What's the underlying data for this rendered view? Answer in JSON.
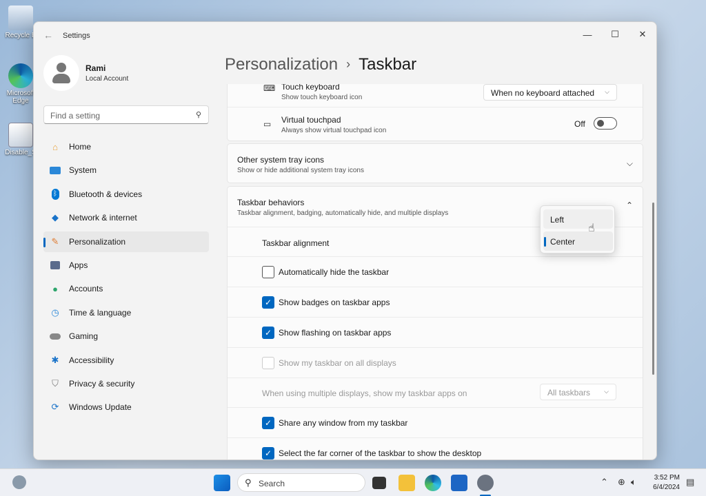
{
  "desktop": {
    "icons": [
      {
        "label": "Recycle B",
        "icon": "recycle-bin-icon"
      },
      {
        "label": "Microsoft Edge",
        "icon": "edge-icon"
      },
      {
        "label": "Disable_S",
        "icon": "script-icon"
      }
    ]
  },
  "window": {
    "title": "Settings",
    "controls": {
      "minimize": "—",
      "maximize": "☐",
      "close": "✕"
    }
  },
  "profile": {
    "name": "Rami",
    "account": "Local Account"
  },
  "search": {
    "placeholder": "Find a setting"
  },
  "nav": [
    {
      "label": "Home",
      "icon": "home-icon",
      "color": "#e8a33d"
    },
    {
      "label": "System",
      "icon": "system-icon",
      "color": "#2b88d8"
    },
    {
      "label": "Bluetooth & devices",
      "icon": "bluetooth-icon",
      "color": "#0078d4"
    },
    {
      "label": "Network & internet",
      "icon": "network-icon",
      "color": "#1a73c9"
    },
    {
      "label": "Personalization",
      "icon": "brush-icon",
      "color": "#e07a2f",
      "active": true
    },
    {
      "label": "Apps",
      "icon": "apps-icon",
      "color": "#5a6b8c"
    },
    {
      "label": "Accounts",
      "icon": "accounts-icon",
      "color": "#2da56c"
    },
    {
      "label": "Time & language",
      "icon": "time-icon",
      "color": "#2b88d8"
    },
    {
      "label": "Gaming",
      "icon": "gaming-icon",
      "color": "#777"
    },
    {
      "label": "Accessibility",
      "icon": "accessibility-icon",
      "color": "#1a73c9"
    },
    {
      "label": "Privacy & security",
      "icon": "shield-icon",
      "color": "#777"
    },
    {
      "label": "Windows Update",
      "icon": "update-icon",
      "color": "#1a73c9"
    }
  ],
  "breadcrumb": {
    "parent": "Personalization",
    "separator": "›",
    "current": "Taskbar"
  },
  "touch_keyboard": {
    "title": "Touch keyboard",
    "subtitle": "Show touch keyboard icon",
    "value": "When no keyboard attached"
  },
  "virtual_touchpad": {
    "title": "Virtual touchpad",
    "subtitle": "Always show virtual touchpad icon",
    "state": "Off"
  },
  "other_tray": {
    "title": "Other system tray icons",
    "subtitle": "Show or hide additional system tray icons"
  },
  "behaviors": {
    "title": "Taskbar behaviors",
    "subtitle": "Taskbar alignment, badging, automatically hide, and multiple displays",
    "alignment_label": "Taskbar alignment",
    "alignment_options": [
      "Left",
      "Center"
    ],
    "alignment_selected": "Center",
    "checks": [
      {
        "label": "Automatically hide the taskbar",
        "checked": false
      },
      {
        "label": "Show badges on taskbar apps",
        "checked": true
      },
      {
        "label": "Show flashing on taskbar apps",
        "checked": true
      },
      {
        "label": "Show my taskbar on all displays",
        "checked": false,
        "disabled": true
      }
    ],
    "multi_display_label": "When using multiple displays, show my taskbar apps on",
    "multi_display_value": "All taskbars",
    "checks2": [
      {
        "label": "Share any window from my taskbar",
        "checked": true
      },
      {
        "label": "Select the far corner of the taskbar to show the desktop",
        "checked": true
      }
    ]
  },
  "taskbar": {
    "search_placeholder": "Search",
    "time": "3:52 PM",
    "date": "6/4/2024"
  },
  "colors": {
    "accent": "#0067c0"
  }
}
